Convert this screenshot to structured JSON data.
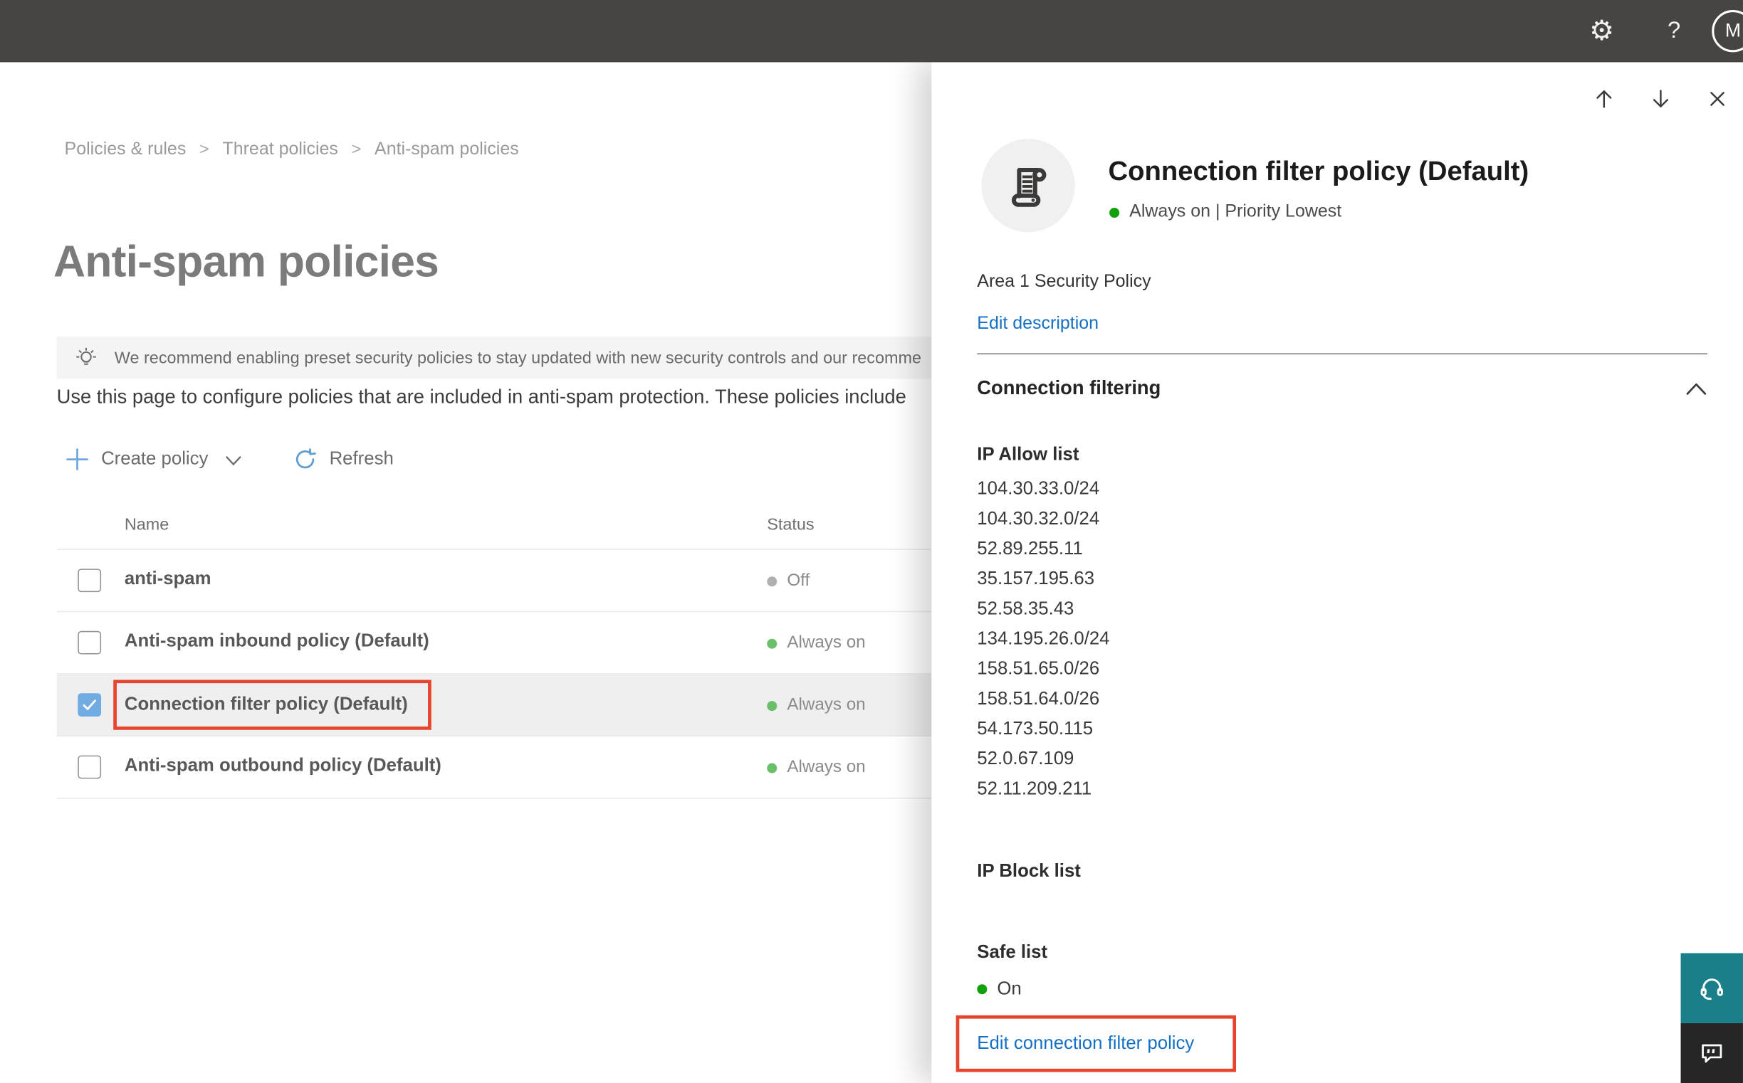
{
  "topbar": {
    "help_label": "?",
    "avatar_initial": "M"
  },
  "breadcrumb": {
    "items": [
      "Policies & rules",
      "Threat policies",
      "Anti-spam policies"
    ],
    "separator": ">"
  },
  "page": {
    "title": "Anti-spam policies",
    "banner_text": "We recommend enabling preset security policies to stay updated with new security controls and our recomme",
    "description": "Use this page to configure policies that are included in anti-spam protection. These policies include"
  },
  "toolbar": {
    "create_policy_label": "Create policy",
    "refresh_label": "Refresh"
  },
  "table": {
    "columns": [
      "Name",
      "Status"
    ],
    "rows": [
      {
        "name": "anti-spam",
        "status": "Off",
        "status_color": "gray",
        "checked": false,
        "selected": false
      },
      {
        "name": "Anti-spam inbound policy (Default)",
        "status": "Always on",
        "status_color": "green",
        "checked": false,
        "selected": false
      },
      {
        "name": "Connection filter policy (Default)",
        "status": "Always on",
        "status_color": "green",
        "checked": true,
        "selected": true,
        "annotated": true
      },
      {
        "name": "Anti-spam outbound policy (Default)",
        "status": "Always on",
        "status_color": "green",
        "checked": false,
        "selected": false
      }
    ]
  },
  "panel": {
    "title": "Connection filter policy (Default)",
    "status_text": "Always on | Priority Lowest",
    "description": "Area 1 Security Policy",
    "edit_description_label": "Edit description",
    "section_title": "Connection filtering",
    "ip_allow": {
      "label": "IP Allow list",
      "ips": [
        "104.30.33.0/24",
        "104.30.32.0/24",
        "52.89.255.11",
        "35.157.195.63",
        "52.58.35.43",
        "134.195.26.0/24",
        "158.51.65.0/26",
        "158.51.64.0/26",
        "54.173.50.115",
        "52.0.67.109",
        "52.11.209.211"
      ]
    },
    "ip_block_label": "IP Block list",
    "safe_list": {
      "label": "Safe list",
      "status": "On"
    },
    "edit_link_label": "Edit connection filter policy"
  },
  "icons": {
    "gear_glyph": "⚙",
    "help_glyph": "?",
    "lightbulb": "lightbulb",
    "plus": "plus",
    "chevron_down": "chevron-down",
    "refresh": "circular-arrow",
    "up_arrow": "arrow-up",
    "down_arrow": "arrow-down",
    "close": "x",
    "scroll": "policy-scroll",
    "chevron_up": "chevron-up",
    "headset": "headset",
    "chat": "speech-bubble",
    "checkmark": "check"
  },
  "colors": {
    "topbar-bg": "#474542",
    "title-gray": "#7b7b7b",
    "breadcrumb-gray": "#9a9a9a",
    "banner-bg": "#f4f4f4",
    "link-blue": "#1470c4",
    "icon-blue": "#5f9dd3",
    "checkbox-blue": "#70ace2",
    "green-dot": "#6bbf6a",
    "green-dot-bright": "#12a10e",
    "gray-dot": "#b0b0b0",
    "annotation-red": "#e8432c",
    "selected-row-bg": "#efefef",
    "teal-button": "#1b7f8a",
    "dark-button": "#262626"
  }
}
